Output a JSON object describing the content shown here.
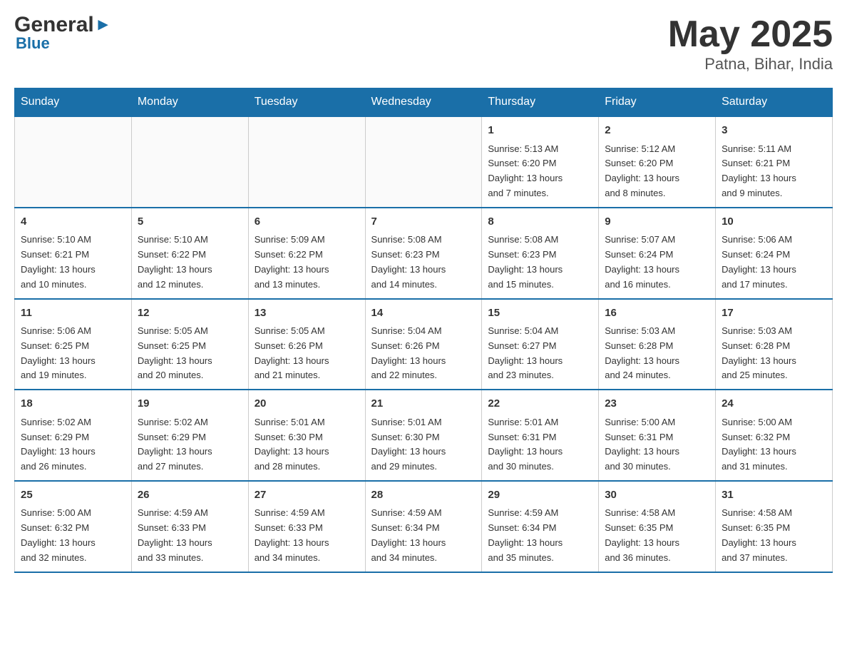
{
  "header": {
    "title": "May 2025",
    "subtitle": "Patna, Bihar, India",
    "logo_general": "General",
    "logo_blue": "Blue"
  },
  "calendar": {
    "days_of_week": [
      "Sunday",
      "Monday",
      "Tuesday",
      "Wednesday",
      "Thursday",
      "Friday",
      "Saturday"
    ],
    "weeks": [
      [
        {
          "day": "",
          "info": ""
        },
        {
          "day": "",
          "info": ""
        },
        {
          "day": "",
          "info": ""
        },
        {
          "day": "",
          "info": ""
        },
        {
          "day": "1",
          "info": "Sunrise: 5:13 AM\nSunset: 6:20 PM\nDaylight: 13 hours\nand 7 minutes."
        },
        {
          "day": "2",
          "info": "Sunrise: 5:12 AM\nSunset: 6:20 PM\nDaylight: 13 hours\nand 8 minutes."
        },
        {
          "day": "3",
          "info": "Sunrise: 5:11 AM\nSunset: 6:21 PM\nDaylight: 13 hours\nand 9 minutes."
        }
      ],
      [
        {
          "day": "4",
          "info": "Sunrise: 5:10 AM\nSunset: 6:21 PM\nDaylight: 13 hours\nand 10 minutes."
        },
        {
          "day": "5",
          "info": "Sunrise: 5:10 AM\nSunset: 6:22 PM\nDaylight: 13 hours\nand 12 minutes."
        },
        {
          "day": "6",
          "info": "Sunrise: 5:09 AM\nSunset: 6:22 PM\nDaylight: 13 hours\nand 13 minutes."
        },
        {
          "day": "7",
          "info": "Sunrise: 5:08 AM\nSunset: 6:23 PM\nDaylight: 13 hours\nand 14 minutes."
        },
        {
          "day": "8",
          "info": "Sunrise: 5:08 AM\nSunset: 6:23 PM\nDaylight: 13 hours\nand 15 minutes."
        },
        {
          "day": "9",
          "info": "Sunrise: 5:07 AM\nSunset: 6:24 PM\nDaylight: 13 hours\nand 16 minutes."
        },
        {
          "day": "10",
          "info": "Sunrise: 5:06 AM\nSunset: 6:24 PM\nDaylight: 13 hours\nand 17 minutes."
        }
      ],
      [
        {
          "day": "11",
          "info": "Sunrise: 5:06 AM\nSunset: 6:25 PM\nDaylight: 13 hours\nand 19 minutes."
        },
        {
          "day": "12",
          "info": "Sunrise: 5:05 AM\nSunset: 6:25 PM\nDaylight: 13 hours\nand 20 minutes."
        },
        {
          "day": "13",
          "info": "Sunrise: 5:05 AM\nSunset: 6:26 PM\nDaylight: 13 hours\nand 21 minutes."
        },
        {
          "day": "14",
          "info": "Sunrise: 5:04 AM\nSunset: 6:26 PM\nDaylight: 13 hours\nand 22 minutes."
        },
        {
          "day": "15",
          "info": "Sunrise: 5:04 AM\nSunset: 6:27 PM\nDaylight: 13 hours\nand 23 minutes."
        },
        {
          "day": "16",
          "info": "Sunrise: 5:03 AM\nSunset: 6:28 PM\nDaylight: 13 hours\nand 24 minutes."
        },
        {
          "day": "17",
          "info": "Sunrise: 5:03 AM\nSunset: 6:28 PM\nDaylight: 13 hours\nand 25 minutes."
        }
      ],
      [
        {
          "day": "18",
          "info": "Sunrise: 5:02 AM\nSunset: 6:29 PM\nDaylight: 13 hours\nand 26 minutes."
        },
        {
          "day": "19",
          "info": "Sunrise: 5:02 AM\nSunset: 6:29 PM\nDaylight: 13 hours\nand 27 minutes."
        },
        {
          "day": "20",
          "info": "Sunrise: 5:01 AM\nSunset: 6:30 PM\nDaylight: 13 hours\nand 28 minutes."
        },
        {
          "day": "21",
          "info": "Sunrise: 5:01 AM\nSunset: 6:30 PM\nDaylight: 13 hours\nand 29 minutes."
        },
        {
          "day": "22",
          "info": "Sunrise: 5:01 AM\nSunset: 6:31 PM\nDaylight: 13 hours\nand 30 minutes."
        },
        {
          "day": "23",
          "info": "Sunrise: 5:00 AM\nSunset: 6:31 PM\nDaylight: 13 hours\nand 30 minutes."
        },
        {
          "day": "24",
          "info": "Sunrise: 5:00 AM\nSunset: 6:32 PM\nDaylight: 13 hours\nand 31 minutes."
        }
      ],
      [
        {
          "day": "25",
          "info": "Sunrise: 5:00 AM\nSunset: 6:32 PM\nDaylight: 13 hours\nand 32 minutes."
        },
        {
          "day": "26",
          "info": "Sunrise: 4:59 AM\nSunset: 6:33 PM\nDaylight: 13 hours\nand 33 minutes."
        },
        {
          "day": "27",
          "info": "Sunrise: 4:59 AM\nSunset: 6:33 PM\nDaylight: 13 hours\nand 34 minutes."
        },
        {
          "day": "28",
          "info": "Sunrise: 4:59 AM\nSunset: 6:34 PM\nDaylight: 13 hours\nand 34 minutes."
        },
        {
          "day": "29",
          "info": "Sunrise: 4:59 AM\nSunset: 6:34 PM\nDaylight: 13 hours\nand 35 minutes."
        },
        {
          "day": "30",
          "info": "Sunrise: 4:58 AM\nSunset: 6:35 PM\nDaylight: 13 hours\nand 36 minutes."
        },
        {
          "day": "31",
          "info": "Sunrise: 4:58 AM\nSunset: 6:35 PM\nDaylight: 13 hours\nand 37 minutes."
        }
      ]
    ]
  }
}
